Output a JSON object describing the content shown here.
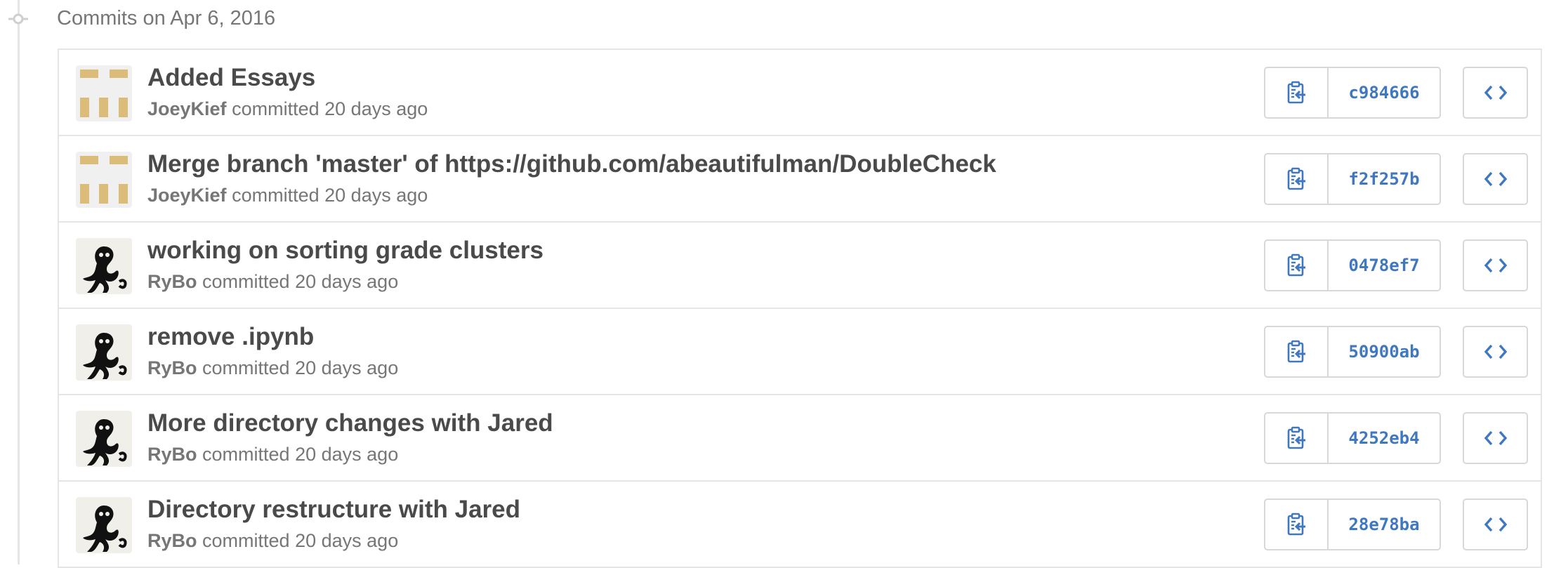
{
  "timeline": {
    "date_header": "Commits on Apr 6, 2016"
  },
  "commits": [
    {
      "title": "Added Essays",
      "author": "JoeyKief",
      "action": "committed",
      "time": "20 days ago",
      "sha": "c984666",
      "avatar": "identicon-avatar"
    },
    {
      "title": "Merge branch 'master' of https://github.com/abeautifulman/DoubleCheck",
      "author": "JoeyKief",
      "action": "committed",
      "time": "20 days ago",
      "sha": "f2f257b",
      "avatar": "identicon-avatar"
    },
    {
      "title": "working on sorting grade clusters",
      "author": "RyBo",
      "action": "committed",
      "time": "20 days ago",
      "sha": "0478ef7",
      "avatar": "octopus-avatar"
    },
    {
      "title": "remove .ipynb",
      "author": "RyBo",
      "action": "committed",
      "time": "20 days ago",
      "sha": "50900ab",
      "avatar": "octopus-avatar"
    },
    {
      "title": "More directory changes with Jared",
      "author": "RyBo",
      "action": "committed",
      "time": "20 days ago",
      "sha": "4252eb4",
      "avatar": "octopus-avatar"
    },
    {
      "title": "Directory restructure with Jared",
      "author": "RyBo",
      "action": "committed",
      "time": "20 days ago",
      "sha": "28e78ba",
      "avatar": "octopus-avatar"
    }
  ],
  "icons": {
    "timeline_node": "git-commit-icon",
    "copy": "clipboard-icon",
    "browse": "code-icon"
  },
  "colors": {
    "link_blue": "#4078c0",
    "identicon_tan": "#dcbc79",
    "border": "#e5e5e5"
  }
}
